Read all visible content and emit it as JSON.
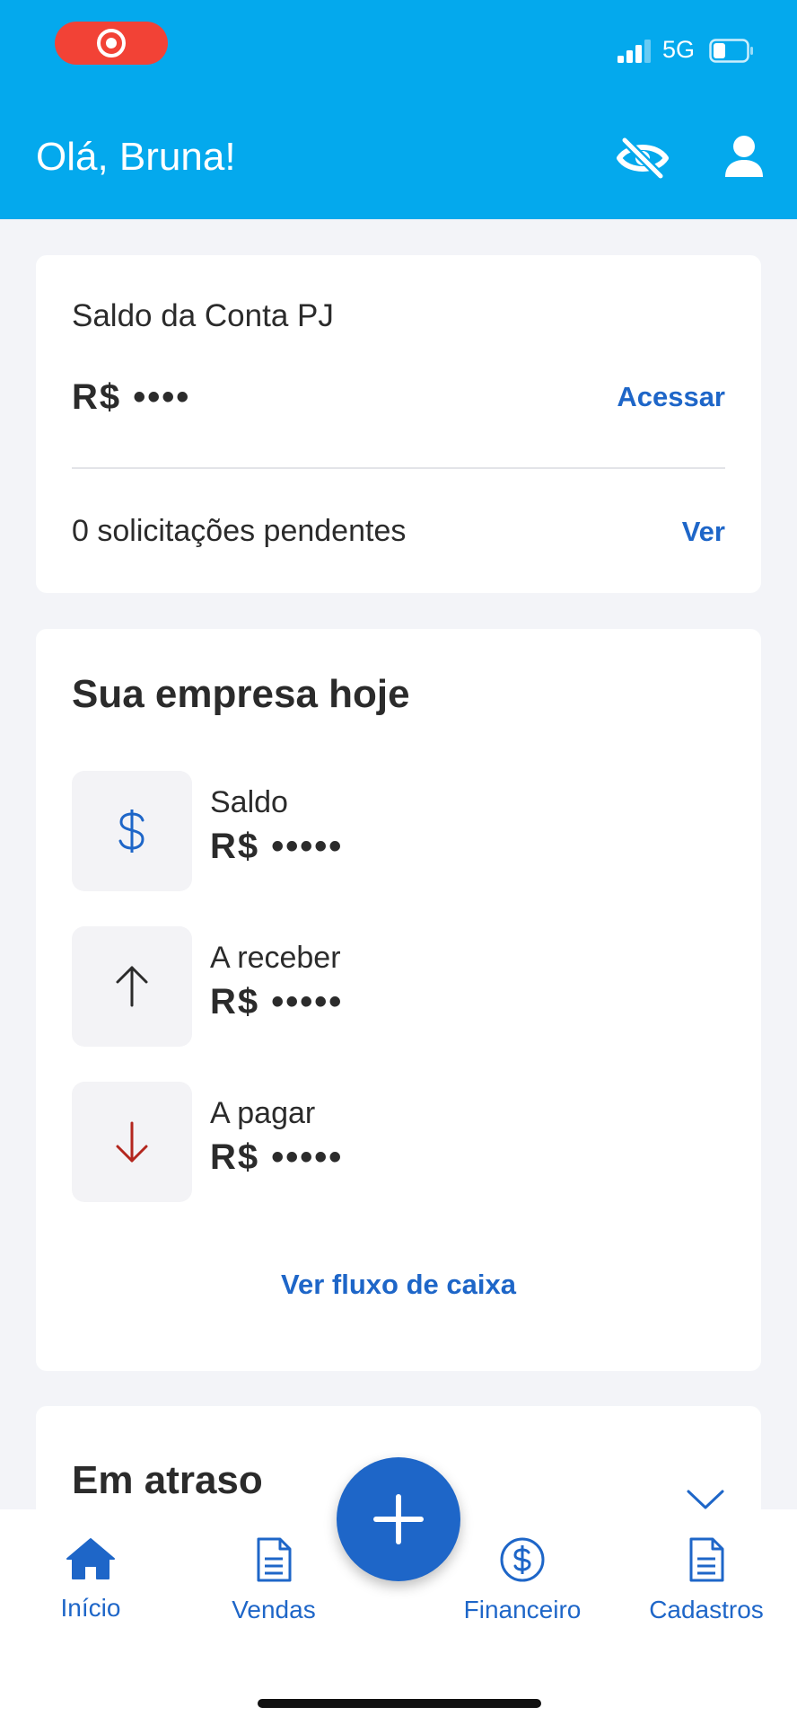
{
  "status_bar": {
    "network": "5G"
  },
  "header": {
    "greeting": "Olá, Bruna!"
  },
  "account_card": {
    "title": "Saldo da Conta PJ",
    "balance": "R$ ••••",
    "access_label": "Acessar",
    "pending_text": "0 solicitações pendentes",
    "view_label": "Ver"
  },
  "company_today": {
    "title": "Sua empresa hoje",
    "rows": [
      {
        "label": "Saldo",
        "value": "R$ •••••",
        "icon": "dollar-icon"
      },
      {
        "label": "A receber",
        "value": "R$ •••••",
        "icon": "arrow-up-icon"
      },
      {
        "label": "A pagar",
        "value": "R$ •••••",
        "icon": "arrow-down-icon"
      }
    ],
    "flow_link": "Ver fluxo de caixa"
  },
  "late_section": {
    "title": "Em atraso"
  },
  "bottom_nav": {
    "items": [
      {
        "label": "Início",
        "icon": "home-icon"
      },
      {
        "label": "Vendas",
        "icon": "document-icon"
      },
      {
        "label": "Financeiro",
        "icon": "dollar-circle-icon"
      },
      {
        "label": "Cadastros",
        "icon": "document-icon"
      }
    ],
    "fab_icon": "plus-icon"
  },
  "colors": {
    "header": "#04a9ed",
    "accent": "#1e66c8",
    "recording": "#f24236",
    "negative": "#b3261e"
  }
}
